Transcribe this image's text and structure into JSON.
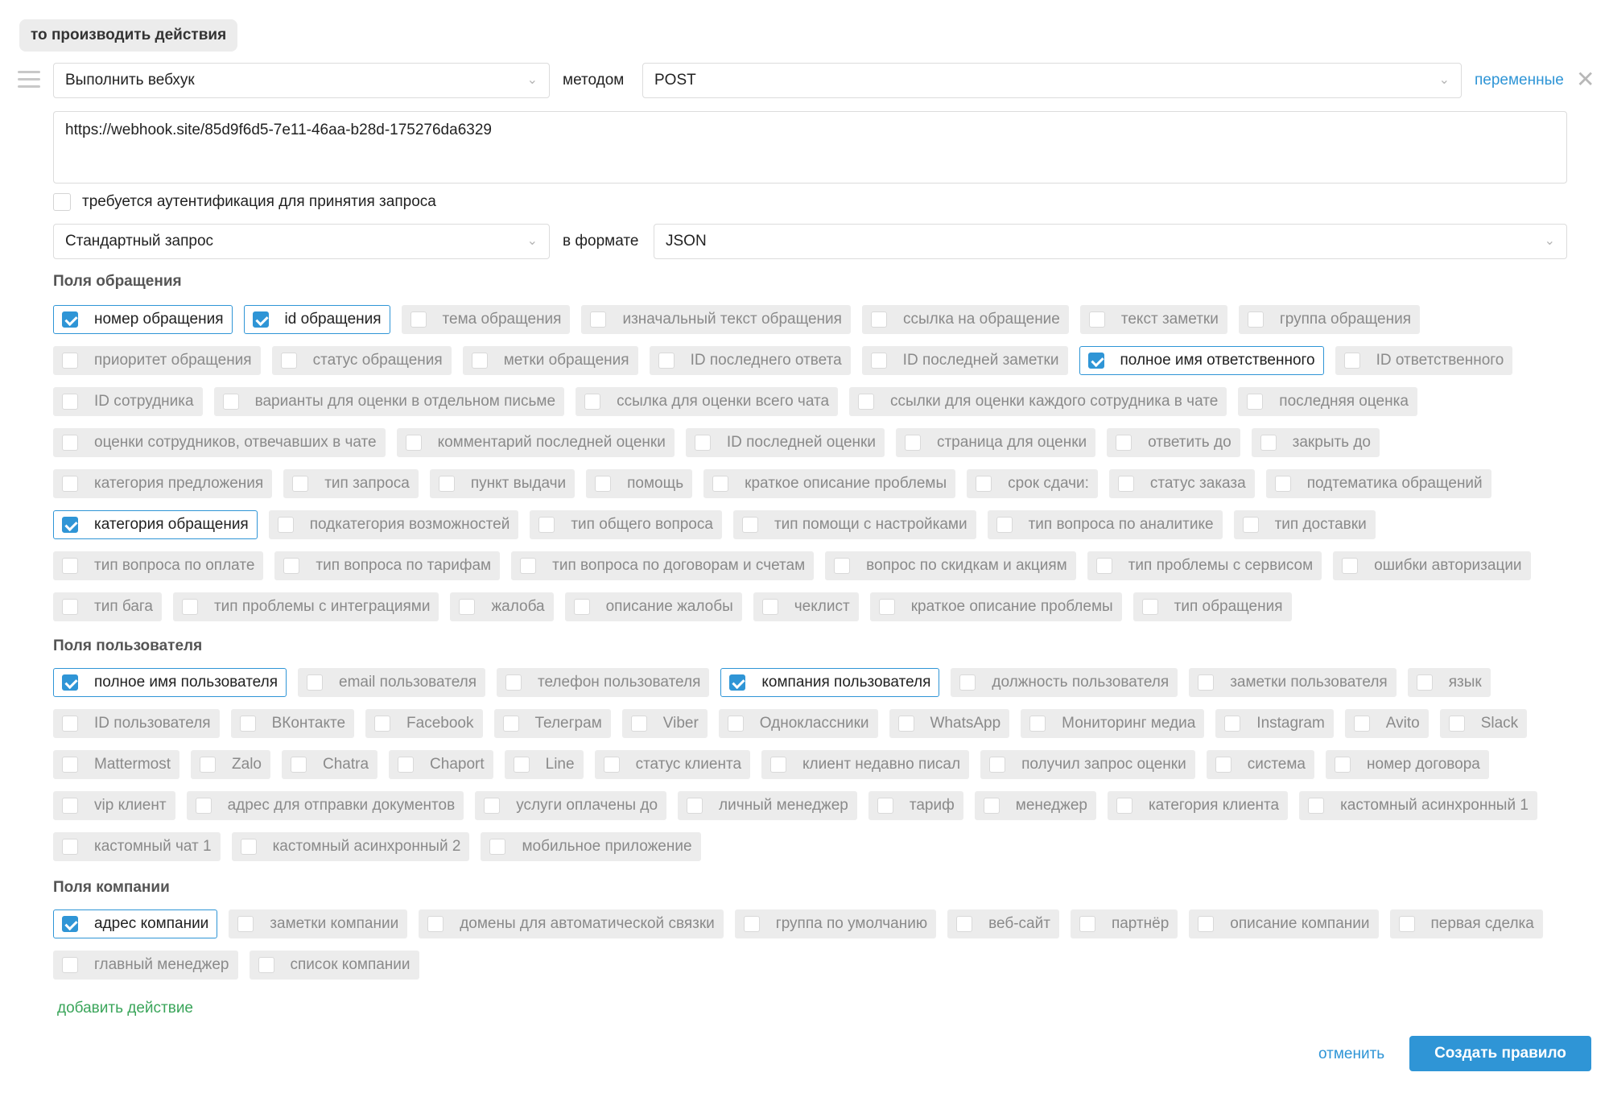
{
  "header": {
    "title": "то производить действия"
  },
  "action": {
    "type_value": "Выполнить вебхук",
    "method_label": "методом",
    "method_value": "POST",
    "variables_link": "переменные",
    "url_value": "https://webhook.site/85d9f6d5-7e11-46aa-b28d-175276da6329",
    "auth_label": "требуется аутентификация для принятия запроса",
    "request_type_value": "Стандартный запрос",
    "format_label": "в формате",
    "format_value": "JSON"
  },
  "sections": {
    "request_fields": {
      "title": "Поля обращения",
      "items": [
        {
          "label": "номер обращения",
          "checked": true
        },
        {
          "label": "id обращения",
          "checked": true
        },
        {
          "label": "тема обращения",
          "checked": false
        },
        {
          "label": "изначальный текст обращения",
          "checked": false
        },
        {
          "label": "ссылка на обращение",
          "checked": false
        },
        {
          "label": "текст заметки",
          "checked": false
        },
        {
          "label": "группа обращения",
          "checked": false
        },
        {
          "label": "приоритет обращения",
          "checked": false
        },
        {
          "label": "статус обращения",
          "checked": false
        },
        {
          "label": "метки обращения",
          "checked": false
        },
        {
          "label": "ID последнего ответа",
          "checked": false
        },
        {
          "label": "ID последней заметки",
          "checked": false
        },
        {
          "label": "полное имя ответственного",
          "checked": true
        },
        {
          "label": "ID ответственного",
          "checked": false
        },
        {
          "label": "ID сотрудника",
          "checked": false
        },
        {
          "label": "варианты для оценки в отдельном письме",
          "checked": false
        },
        {
          "label": "ссылка для оценки всего чата",
          "checked": false
        },
        {
          "label": "ссылки для оценки каждого сотрудника в чате",
          "checked": false
        },
        {
          "label": "последняя оценка",
          "checked": false
        },
        {
          "label": "оценки сотрудников, отвечавших в чате",
          "checked": false
        },
        {
          "label": "комментарий последней оценки",
          "checked": false
        },
        {
          "label": "ID последней оценки",
          "checked": false
        },
        {
          "label": "страница для оценки",
          "checked": false
        },
        {
          "label": "ответить до",
          "checked": false
        },
        {
          "label": "закрыть до",
          "checked": false
        },
        {
          "label": "категория предложения",
          "checked": false
        },
        {
          "label": "тип запроса",
          "checked": false
        },
        {
          "label": "пункт выдачи",
          "checked": false
        },
        {
          "label": "помощь",
          "checked": false
        },
        {
          "label": "краткое описание проблемы",
          "checked": false
        },
        {
          "label": "срок сдачи:",
          "checked": false
        },
        {
          "label": "статус заказа",
          "checked": false
        },
        {
          "label": "подтематика обращений",
          "checked": false
        },
        {
          "label": "категория обращения",
          "checked": true
        },
        {
          "label": "подкатегория возможностей",
          "checked": false
        },
        {
          "label": "тип общего вопроса",
          "checked": false
        },
        {
          "label": "тип помощи с настройками",
          "checked": false
        },
        {
          "label": "тип вопроса по аналитике",
          "checked": false
        },
        {
          "label": "тип доставки",
          "checked": false
        },
        {
          "label": "тип вопроса по оплате",
          "checked": false
        },
        {
          "label": "тип вопроса по тарифам",
          "checked": false
        },
        {
          "label": "тип вопроса по договорам и счетам",
          "checked": false
        },
        {
          "label": "вопрос по скидкам и акциям",
          "checked": false
        },
        {
          "label": "тип проблемы с сервисом",
          "checked": false
        },
        {
          "label": "ошибки авторизации",
          "checked": false
        },
        {
          "label": "тип бага",
          "checked": false
        },
        {
          "label": "тип проблемы с интеграциями",
          "checked": false
        },
        {
          "label": "жалоба",
          "checked": false
        },
        {
          "label": "описание жалобы",
          "checked": false
        },
        {
          "label": "чеклист",
          "checked": false
        },
        {
          "label": "краткое описание проблемы",
          "checked": false
        },
        {
          "label": "тип обращения",
          "checked": false
        }
      ]
    },
    "user_fields": {
      "title": "Поля пользователя",
      "items": [
        {
          "label": "полное имя пользователя",
          "checked": true
        },
        {
          "label": "email пользователя",
          "checked": false
        },
        {
          "label": "телефон пользователя",
          "checked": false
        },
        {
          "label": "компания пользователя",
          "checked": true
        },
        {
          "label": "должность пользователя",
          "checked": false
        },
        {
          "label": "заметки пользователя",
          "checked": false
        },
        {
          "label": "язык",
          "checked": false
        },
        {
          "label": "ID пользователя",
          "checked": false
        },
        {
          "label": "ВКонтакте",
          "checked": false
        },
        {
          "label": "Facebook",
          "checked": false
        },
        {
          "label": "Телеграм",
          "checked": false
        },
        {
          "label": "Viber",
          "checked": false
        },
        {
          "label": "Одноклассники",
          "checked": false
        },
        {
          "label": "WhatsApp",
          "checked": false
        },
        {
          "label": "Мониторинг медиа",
          "checked": false
        },
        {
          "label": "Instagram",
          "checked": false
        },
        {
          "label": "Avito",
          "checked": false
        },
        {
          "label": "Slack",
          "checked": false
        },
        {
          "label": "Mattermost",
          "checked": false
        },
        {
          "label": "Zalo",
          "checked": false
        },
        {
          "label": "Chatra",
          "checked": false
        },
        {
          "label": "Chaport",
          "checked": false
        },
        {
          "label": "Line",
          "checked": false
        },
        {
          "label": "статус клиента",
          "checked": false
        },
        {
          "label": "клиент недавно писал",
          "checked": false
        },
        {
          "label": "получил запрос оценки",
          "checked": false
        },
        {
          "label": "система",
          "checked": false
        },
        {
          "label": "номер договора",
          "checked": false
        },
        {
          "label": "vip клиент",
          "checked": false
        },
        {
          "label": "адрес для отправки документов",
          "checked": false
        },
        {
          "label": "услуги оплачены до",
          "checked": false
        },
        {
          "label": "личный менеджер",
          "checked": false
        },
        {
          "label": "тариф",
          "checked": false
        },
        {
          "label": "менеджер",
          "checked": false
        },
        {
          "label": "категория клиента",
          "checked": false
        },
        {
          "label": "кастомный асинхронный 1",
          "checked": false
        },
        {
          "label": "кастомный чат 1",
          "checked": false
        },
        {
          "label": "кастомный асинхронный 2",
          "checked": false
        },
        {
          "label": "мобильное приложение",
          "checked": false
        }
      ]
    },
    "company_fields": {
      "title": "Поля компании",
      "items": [
        {
          "label": "адрес компании",
          "checked": true
        },
        {
          "label": "заметки компании",
          "checked": false
        },
        {
          "label": "домены для автоматической связки",
          "checked": false
        },
        {
          "label": "группа по умолчанию",
          "checked": false
        },
        {
          "label": "веб-сайт",
          "checked": false
        },
        {
          "label": "партнёр",
          "checked": false
        },
        {
          "label": "описание компании",
          "checked": false
        },
        {
          "label": "первая сделка",
          "checked": false
        },
        {
          "label": "главный менеджер",
          "checked": false
        },
        {
          "label": "список компании",
          "checked": false
        }
      ]
    }
  },
  "footer": {
    "add_action": "добавить действие",
    "cancel": "отменить",
    "create": "Создать правило"
  },
  "colors": {
    "accent": "#2f95d6",
    "add_link": "#3aa55a",
    "chip_bg": "#ececec"
  }
}
